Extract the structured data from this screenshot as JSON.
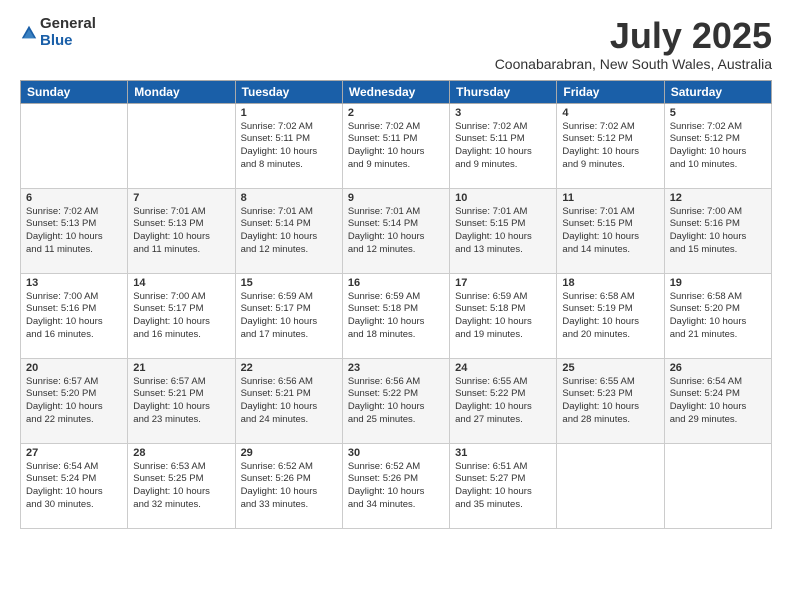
{
  "logo": {
    "general": "General",
    "blue": "Blue"
  },
  "title": "July 2025",
  "location": "Coonabarabran, New South Wales, Australia",
  "weekdays": [
    "Sunday",
    "Monday",
    "Tuesday",
    "Wednesday",
    "Thursday",
    "Friday",
    "Saturday"
  ],
  "weeks": [
    [
      {
        "day": "",
        "content": ""
      },
      {
        "day": "",
        "content": ""
      },
      {
        "day": "1",
        "content": "Sunrise: 7:02 AM\nSunset: 5:11 PM\nDaylight: 10 hours\nand 8 minutes."
      },
      {
        "day": "2",
        "content": "Sunrise: 7:02 AM\nSunset: 5:11 PM\nDaylight: 10 hours\nand 9 minutes."
      },
      {
        "day": "3",
        "content": "Sunrise: 7:02 AM\nSunset: 5:11 PM\nDaylight: 10 hours\nand 9 minutes."
      },
      {
        "day": "4",
        "content": "Sunrise: 7:02 AM\nSunset: 5:12 PM\nDaylight: 10 hours\nand 9 minutes."
      },
      {
        "day": "5",
        "content": "Sunrise: 7:02 AM\nSunset: 5:12 PM\nDaylight: 10 hours\nand 10 minutes."
      }
    ],
    [
      {
        "day": "6",
        "content": "Sunrise: 7:02 AM\nSunset: 5:13 PM\nDaylight: 10 hours\nand 11 minutes."
      },
      {
        "day": "7",
        "content": "Sunrise: 7:01 AM\nSunset: 5:13 PM\nDaylight: 10 hours\nand 11 minutes."
      },
      {
        "day": "8",
        "content": "Sunrise: 7:01 AM\nSunset: 5:14 PM\nDaylight: 10 hours\nand 12 minutes."
      },
      {
        "day": "9",
        "content": "Sunrise: 7:01 AM\nSunset: 5:14 PM\nDaylight: 10 hours\nand 12 minutes."
      },
      {
        "day": "10",
        "content": "Sunrise: 7:01 AM\nSunset: 5:15 PM\nDaylight: 10 hours\nand 13 minutes."
      },
      {
        "day": "11",
        "content": "Sunrise: 7:01 AM\nSunset: 5:15 PM\nDaylight: 10 hours\nand 14 minutes."
      },
      {
        "day": "12",
        "content": "Sunrise: 7:00 AM\nSunset: 5:16 PM\nDaylight: 10 hours\nand 15 minutes."
      }
    ],
    [
      {
        "day": "13",
        "content": "Sunrise: 7:00 AM\nSunset: 5:16 PM\nDaylight: 10 hours\nand 16 minutes."
      },
      {
        "day": "14",
        "content": "Sunrise: 7:00 AM\nSunset: 5:17 PM\nDaylight: 10 hours\nand 16 minutes."
      },
      {
        "day": "15",
        "content": "Sunrise: 6:59 AM\nSunset: 5:17 PM\nDaylight: 10 hours\nand 17 minutes."
      },
      {
        "day": "16",
        "content": "Sunrise: 6:59 AM\nSunset: 5:18 PM\nDaylight: 10 hours\nand 18 minutes."
      },
      {
        "day": "17",
        "content": "Sunrise: 6:59 AM\nSunset: 5:18 PM\nDaylight: 10 hours\nand 19 minutes."
      },
      {
        "day": "18",
        "content": "Sunrise: 6:58 AM\nSunset: 5:19 PM\nDaylight: 10 hours\nand 20 minutes."
      },
      {
        "day": "19",
        "content": "Sunrise: 6:58 AM\nSunset: 5:20 PM\nDaylight: 10 hours\nand 21 minutes."
      }
    ],
    [
      {
        "day": "20",
        "content": "Sunrise: 6:57 AM\nSunset: 5:20 PM\nDaylight: 10 hours\nand 22 minutes."
      },
      {
        "day": "21",
        "content": "Sunrise: 6:57 AM\nSunset: 5:21 PM\nDaylight: 10 hours\nand 23 minutes."
      },
      {
        "day": "22",
        "content": "Sunrise: 6:56 AM\nSunset: 5:21 PM\nDaylight: 10 hours\nand 24 minutes."
      },
      {
        "day": "23",
        "content": "Sunrise: 6:56 AM\nSunset: 5:22 PM\nDaylight: 10 hours\nand 25 minutes."
      },
      {
        "day": "24",
        "content": "Sunrise: 6:55 AM\nSunset: 5:22 PM\nDaylight: 10 hours\nand 27 minutes."
      },
      {
        "day": "25",
        "content": "Sunrise: 6:55 AM\nSunset: 5:23 PM\nDaylight: 10 hours\nand 28 minutes."
      },
      {
        "day": "26",
        "content": "Sunrise: 6:54 AM\nSunset: 5:24 PM\nDaylight: 10 hours\nand 29 minutes."
      }
    ],
    [
      {
        "day": "27",
        "content": "Sunrise: 6:54 AM\nSunset: 5:24 PM\nDaylight: 10 hours\nand 30 minutes."
      },
      {
        "day": "28",
        "content": "Sunrise: 6:53 AM\nSunset: 5:25 PM\nDaylight: 10 hours\nand 32 minutes."
      },
      {
        "day": "29",
        "content": "Sunrise: 6:52 AM\nSunset: 5:26 PM\nDaylight: 10 hours\nand 33 minutes."
      },
      {
        "day": "30",
        "content": "Sunrise: 6:52 AM\nSunset: 5:26 PM\nDaylight: 10 hours\nand 34 minutes."
      },
      {
        "day": "31",
        "content": "Sunrise: 6:51 AM\nSunset: 5:27 PM\nDaylight: 10 hours\nand 35 minutes."
      },
      {
        "day": "",
        "content": ""
      },
      {
        "day": "",
        "content": ""
      }
    ]
  ]
}
